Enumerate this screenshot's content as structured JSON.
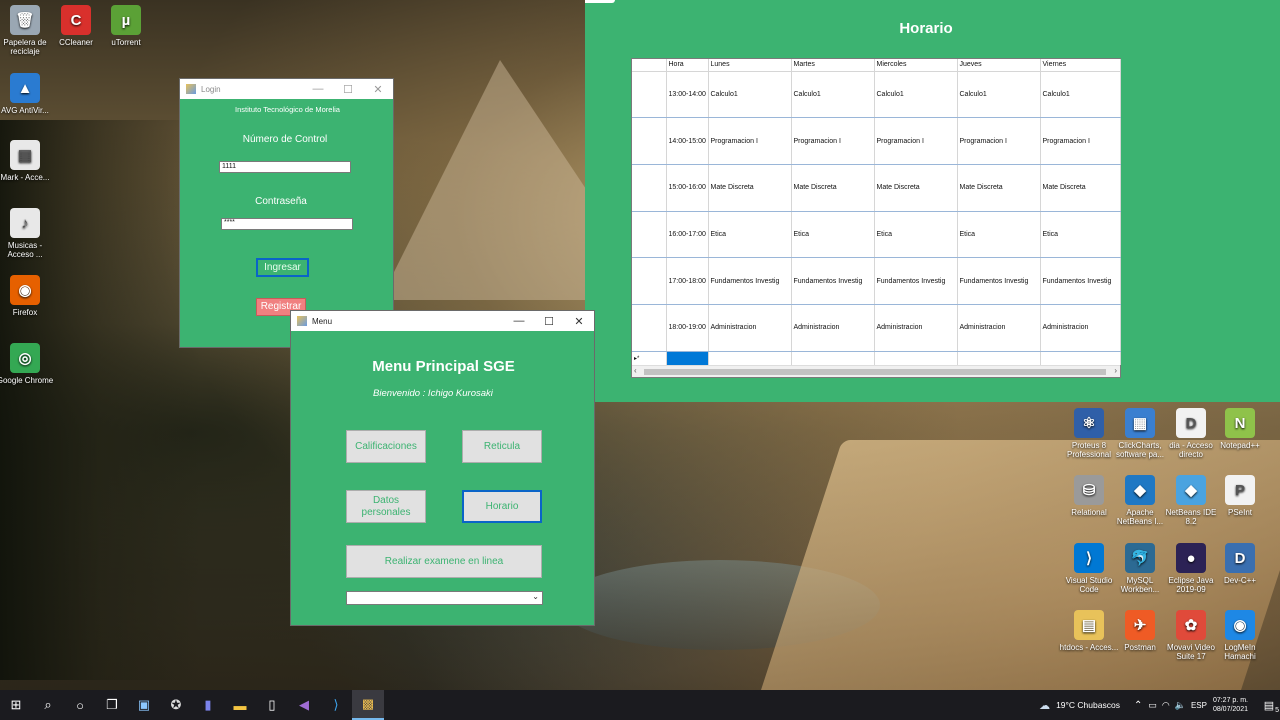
{
  "desktop": {
    "left_icons": [
      {
        "name": "recycle-bin-icon",
        "label": "Papelera de reciclaje",
        "color": "#9aa7b3",
        "glyph": "🗑"
      },
      {
        "name": "ccleaner-icon",
        "label": "CCleaner",
        "color": "#d9302c",
        "glyph": "C"
      },
      {
        "name": "utorrent-icon",
        "label": "uTorrent",
        "color": "#5ba136",
        "glyph": "µ"
      },
      {
        "name": "avg-icon",
        "label": "AVG AntiVir...",
        "color": "#2a7bd1",
        "glyph": "▲"
      },
      {
        "name": "file-icon",
        "label": "Mark - Acce...",
        "color": "#e8e8e8",
        "glyph": "▤"
      },
      {
        "name": "music-icon",
        "label": "Musicas - Acceso ...",
        "color": "#e8e8e8",
        "glyph": "♪"
      },
      {
        "name": "firefox-icon",
        "label": "Firefox",
        "color": "#e66000",
        "glyph": "◉"
      },
      {
        "name": "chrome-icon",
        "label": "Google Chrome",
        "color": "#34a853",
        "glyph": "◎"
      }
    ],
    "right_icons": [
      {
        "name": "proteus-icon",
        "label": "Proteus 8 Professional",
        "color": "#2f5fa8",
        "glyph": "⚛"
      },
      {
        "name": "clickcharts-icon",
        "label": "ClickCharts, software pa...",
        "color": "#3a7fd0",
        "glyph": "▦"
      },
      {
        "name": "dia-icon",
        "label": "dia - Acceso directo",
        "color": "#f2f2f2",
        "glyph": "D"
      },
      {
        "name": "notepadpp-icon",
        "label": "Notepad++",
        "color": "#8fc24a",
        "glyph": "N"
      },
      {
        "name": "relational-icon",
        "label": "Relational",
        "color": "#9a9a9a",
        "glyph": "⛁"
      },
      {
        "name": "netbeans-icon",
        "label": "Apache NetBeans I...",
        "color": "#1f78c4",
        "glyph": "◆"
      },
      {
        "name": "netbeans82-icon",
        "label": "NetBeans IDE 8.2",
        "color": "#4aa3e0",
        "glyph": "◆"
      },
      {
        "name": "pseint-icon",
        "label": "PSeInt",
        "color": "#f2f2f2",
        "glyph": "P"
      },
      {
        "name": "vscode-icon",
        "label": "Visual Studio Code",
        "color": "#0078d4",
        "glyph": "⟩"
      },
      {
        "name": "mysql-icon",
        "label": "MySQL Workben...",
        "color": "#2c6a93",
        "glyph": "🐬"
      },
      {
        "name": "eclipse-icon",
        "label": "Eclipse Java 2019-09",
        "color": "#2c2255",
        "glyph": "●"
      },
      {
        "name": "devcpp-icon",
        "label": "Dev-C++",
        "color": "#3a6fb0",
        "glyph": "D"
      },
      {
        "name": "htdocs-icon",
        "label": "htdocs - Acces...",
        "color": "#e8c25a",
        "glyph": "▤"
      },
      {
        "name": "postman-icon",
        "label": "Postman",
        "color": "#ef5b25",
        "glyph": "✈"
      },
      {
        "name": "movavi-icon",
        "label": "Movavi Video Suite 17",
        "color": "#e04a3a",
        "glyph": "✿"
      },
      {
        "name": "logmein-icon",
        "label": "LogMeIn Hamachi",
        "color": "#1e88e5",
        "glyph": "◉"
      }
    ]
  },
  "login": {
    "title": "Login",
    "institute": "Instituto Tecnológico de Morelia",
    "control_label": "Número de Control",
    "control_value": "1111",
    "password_label": "Contraseña",
    "password_value": "****",
    "ingresar_label": "Ingresar",
    "registrar_label": "Registrar"
  },
  "menu": {
    "title": "Menu",
    "heading": "Menu Principal SGE",
    "welcome": "Bienvenido : Ichigo Kurosaki",
    "calificaciones_label": "Calificaciones",
    "reticula_label": "Reticula",
    "datos_label": "Datos personales",
    "horario_label": "Horario",
    "examen_label": "Realizar examene en linea",
    "dropdown_value": ""
  },
  "horario": {
    "title": "Horario",
    "columns": [
      "Hora",
      "Lunes",
      "Martes",
      "Miercoles",
      "Jueves",
      "Viernes"
    ],
    "rows": [
      [
        "13:00-14:00",
        "Calculo1",
        "Calculo1",
        "Calculo1",
        "Calculo1",
        "Calculo1"
      ],
      [
        "14:00-15:00",
        "Programacion I",
        "Programacion I",
        "Programacion I",
        "Programacion I",
        "Programacion I"
      ],
      [
        "15:00-16:00",
        "Mate Discreta",
        "Mate Discreta",
        "Mate Discreta",
        "Mate Discreta",
        "Mate Discreta"
      ],
      [
        "16:00-17:00",
        "Etica",
        "Etica",
        "Etica",
        "Etica",
        "Etica"
      ],
      [
        "17:00-18:00",
        "Fundamentos Investig",
        "Fundamentos Investig",
        "Fundamentos Investig",
        "Fundamentos Investig",
        "Fundamentos Investig"
      ],
      [
        "18:00-19:00",
        "Administracion",
        "Administracion",
        "Administracion",
        "Administracion",
        "Administracion"
      ]
    ],
    "new_row_marker": "▸*"
  },
  "taskbar": {
    "weather": "19°C  Chubascos",
    "time": "07:27 p. m.",
    "date": "08/07/2021",
    "notifications": "5"
  }
}
